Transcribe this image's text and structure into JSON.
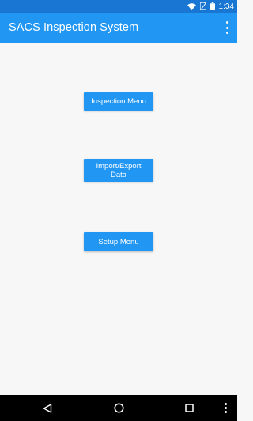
{
  "status_bar": {
    "time": "1:34",
    "icons": [
      "wifi-icon",
      "sim-no-service-icon",
      "battery-icon"
    ]
  },
  "app_bar": {
    "title": "SACS Inspection System",
    "menu_icon": "overflow-menu-icon"
  },
  "main": {
    "buttons": [
      {
        "label": "Inspection Menu"
      },
      {
        "label": "Import/Export Data"
      },
      {
        "label": "Setup Menu"
      }
    ]
  },
  "nav_bar": {
    "icons": [
      "back-icon",
      "home-icon",
      "recents-icon",
      "menu-icon"
    ]
  },
  "colors": {
    "primary": "#2196f3",
    "primary_dark": "#1976d2",
    "background": "#f7f7f7",
    "nav_bar": "#000000"
  }
}
